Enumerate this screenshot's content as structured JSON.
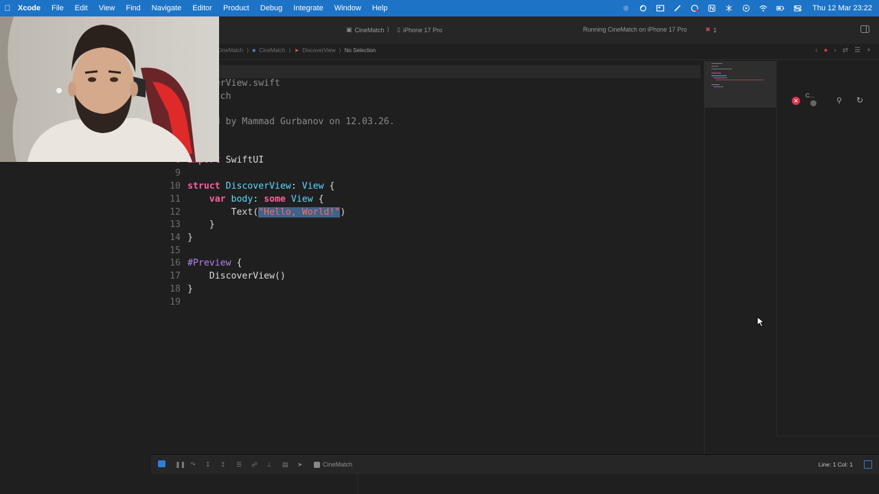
{
  "menubar": {
    "app": "Xcode",
    "items": [
      "File",
      "Edit",
      "View",
      "Find",
      "Navigate",
      "Editor",
      "Product",
      "Debug",
      "Integrate",
      "Window",
      "Help"
    ],
    "clock": "Thu 12 Mar 23:22"
  },
  "toolbar": {
    "scheme": "CineMatch",
    "destination": "iPhone 17 Pro",
    "status": "Running CineMatch on iPhone 17 Pro",
    "issue_count": "1"
  },
  "jumpbar": {
    "project": "CineMatch",
    "group": "CineMatch",
    "file": "DiscoverView",
    "selection": "No Selection"
  },
  "editor": {
    "visible_lines": [
      {
        "n": "",
        "text": "iscoverView.swift"
      },
      {
        "n": "",
        "text": "ineMatch"
      },
      {
        "n": "",
        "text": "reated by Mammad Gurbanov on 12.03.26."
      },
      {
        "n": "8",
        "text": "import SwiftUI"
      },
      {
        "n": "9",
        "text": ""
      },
      {
        "n": "10",
        "text": "struct DiscoverView: View {"
      },
      {
        "n": "11",
        "text": "var body: some View {"
      },
      {
        "n": "12",
        "text": "Text(\"Hello, World!\")"
      },
      {
        "n": "13",
        "text": "}"
      },
      {
        "n": "14",
        "text": "}"
      },
      {
        "n": "15",
        "text": ""
      },
      {
        "n": "16",
        "text": "#Preview {"
      },
      {
        "n": "17",
        "text": "DiscoverView()"
      },
      {
        "n": "18",
        "text": "}"
      },
      {
        "n": "19",
        "text": ""
      }
    ],
    "tokens": {
      "file_name": "iscoverView.swift",
      "project_name": "ineMatch",
      "created_by": "reated by Mammad Gurbanov on 12.03.26.",
      "import_kw": "import",
      "import_mod": "SwiftUI",
      "struct_kw": "struct",
      "struct_name": "DiscoverView",
      "colon": ": ",
      "view_type": "View",
      "brace_open": " {",
      "var_kw": "var",
      "body_name": "body",
      "some_kw": "some",
      "text_call": "Text(",
      "string_lit": "\"Hello, World!\"",
      "paren_close": ")",
      "brace_close": "}",
      "preview_dir": "#Preview",
      "preview_call": "DiscoverView()"
    }
  },
  "inspector": {
    "label": "C..."
  },
  "debugbar": {
    "process": "CineMatch",
    "position": "Line: 1  Col: 1"
  },
  "colors": {
    "menubar": "#1d73c6",
    "keyword": "#fc5fa3",
    "type": "#5dd8ff",
    "string": "#fc6a5d",
    "comment": "#8a8a8a",
    "error": "#e0304a"
  }
}
